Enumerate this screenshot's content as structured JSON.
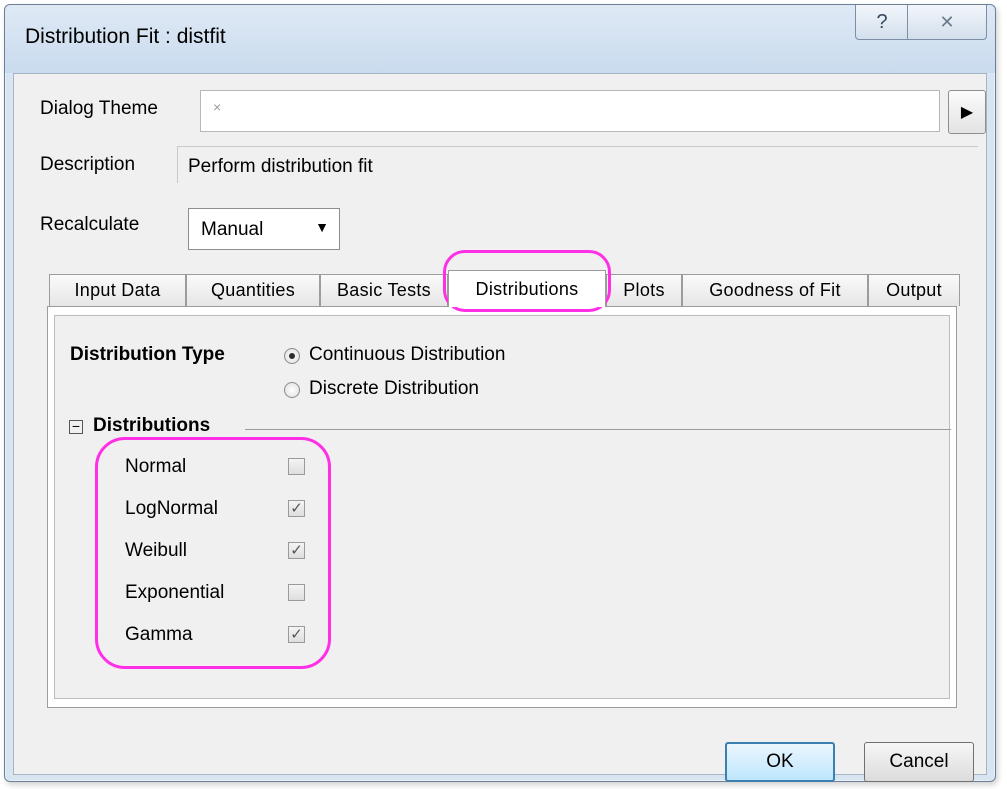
{
  "window": {
    "title": "Distribution Fit : distfit",
    "help_glyph": "?",
    "close_glyph": "✕"
  },
  "dialog_theme": {
    "label": "Dialog Theme",
    "value": "×",
    "arrow": "▶"
  },
  "description": {
    "label": "Description",
    "value": "Perform distribution fit"
  },
  "recalculate": {
    "label": "Recalculate",
    "value": "Manual",
    "caret": "▼"
  },
  "tabs": [
    {
      "label": "Input Data"
    },
    {
      "label": "Quantities"
    },
    {
      "label": "Basic Tests"
    },
    {
      "label": "Distributions"
    },
    {
      "label": "Plots"
    },
    {
      "label": "Goodness of Fit"
    },
    {
      "label": "Output"
    }
  ],
  "active_tab": "Distributions",
  "distribution_type": {
    "label": "Distribution Type",
    "options": [
      "Continuous Distribution",
      "Discrete Distribution"
    ],
    "selected": "Continuous Distribution"
  },
  "distributions_section": {
    "title": "Distributions",
    "toggle": "−",
    "items": [
      {
        "label": "Normal",
        "checked": false
      },
      {
        "label": "LogNormal",
        "checked": true
      },
      {
        "label": "Weibull",
        "checked": true
      },
      {
        "label": "Exponential",
        "checked": false
      },
      {
        "label": "Gamma",
        "checked": true
      }
    ]
  },
  "check_mark": "✓",
  "buttons": {
    "ok": "OK",
    "cancel": "Cancel"
  },
  "colors": {
    "highlight": "#ff2fe6",
    "titlebar": "#d7e4f2",
    "dialog_bg": "#f0f0f0"
  }
}
